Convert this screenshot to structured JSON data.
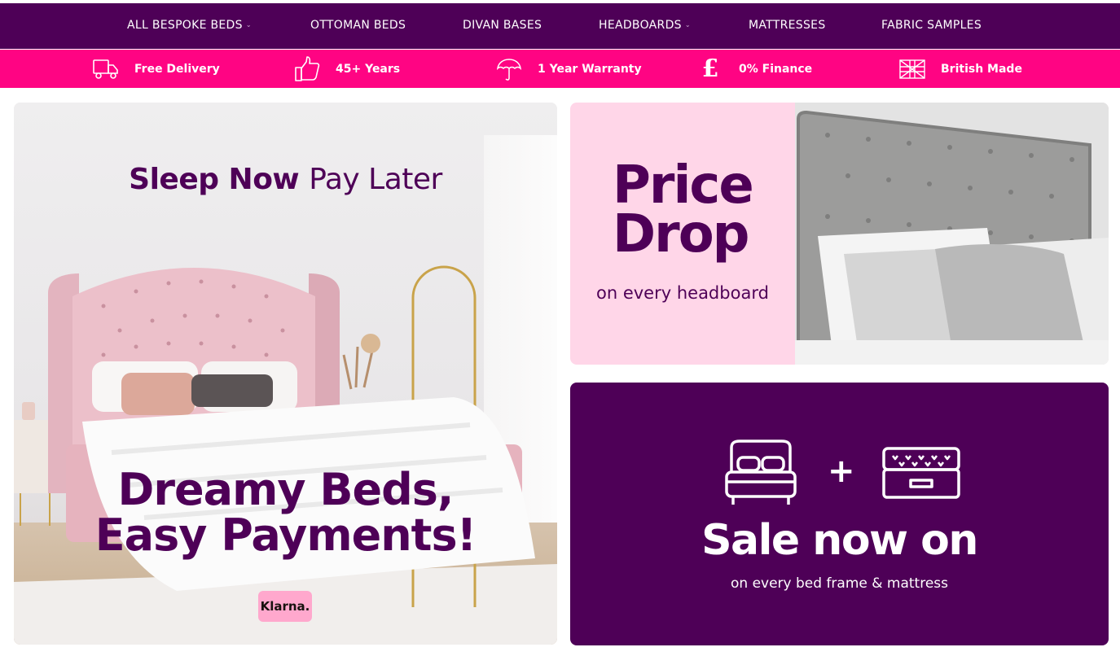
{
  "nav": {
    "items": [
      {
        "label": "ALL BESPOKE BEDS",
        "has_dropdown": true
      },
      {
        "label": "OTTOMAN BEDS",
        "has_dropdown": false
      },
      {
        "label": "DIVAN BASES",
        "has_dropdown": false
      },
      {
        "label": "HEADBOARDS",
        "has_dropdown": true
      },
      {
        "label": "MATTRESSES",
        "has_dropdown": false
      },
      {
        "label": "FABRIC SAMPLES",
        "has_dropdown": false
      }
    ],
    "dropdown_glyph": "⌄"
  },
  "usp": {
    "items": [
      {
        "icon": "delivery-truck-icon",
        "label": "Free Delivery"
      },
      {
        "icon": "thumbs-up-icon",
        "label": "45+ Years"
      },
      {
        "icon": "umbrella-icon",
        "label": "1 Year Warranty"
      },
      {
        "icon": "pound-sign-icon",
        "label": "0% Finance",
        "glyph": "£"
      },
      {
        "icon": "union-jack-icon",
        "label": "British Made"
      }
    ]
  },
  "banners": {
    "klarna": {
      "title_bold": "Sleep Now",
      "title_light": "Pay Later",
      "headline_line1": "Dreamy Beds,",
      "headline_line2": "Easy Payments!",
      "badge": "Klarna."
    },
    "price_drop": {
      "title_line1": "Price",
      "title_line2": "Drop",
      "subtitle": "on every headboard"
    },
    "sale": {
      "icons": [
        "bed-icon",
        "plus-icon",
        "mattress-icon"
      ],
      "plus_glyph": "+",
      "title": "Sale now on",
      "subtitle": "on every bed frame & mattress"
    }
  },
  "colors": {
    "brand_purple": "#4e0057",
    "brand_pink": "#ff0483",
    "soft_pink": "#ffd6e8",
    "klarna_pink": "#ffa8cd"
  }
}
